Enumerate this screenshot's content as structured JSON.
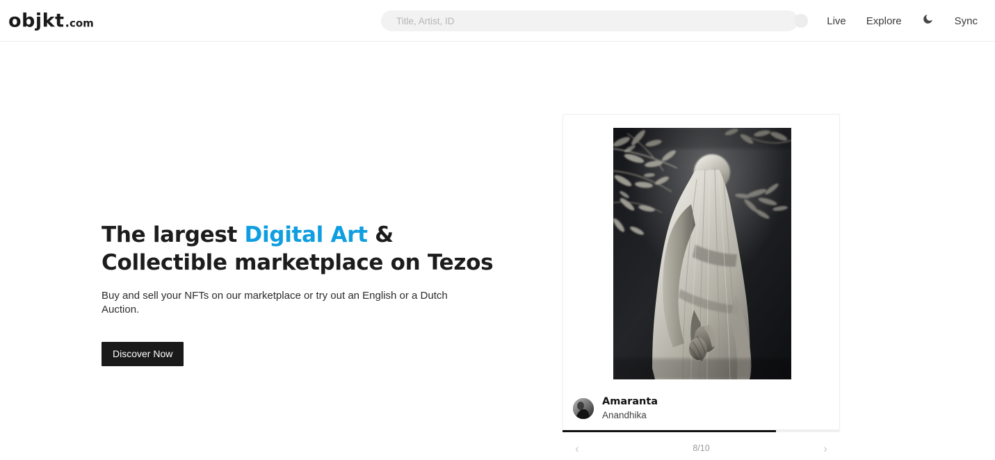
{
  "header": {
    "logo": {
      "name": "objkt",
      "dot": ".",
      "tld": "com"
    },
    "search": {
      "placeholder": "Title, Artist, ID",
      "value": ""
    },
    "nav": {
      "live": "Live",
      "explore": "Explore",
      "theme_toggle_icon": "moon-icon",
      "sync": "Sync",
      "avatar_icon": "avatar-placeholder-icon"
    }
  },
  "hero": {
    "title_part1": "The largest ",
    "title_accent": "Digital Art",
    "title_part2": " & Collectible marketplace on Tezos",
    "subtitle": "Buy and sell your NFTs on our marketplace or try out an English or a Dutch Auction.",
    "cta_label": "Discover Now",
    "accent_color": "#0f9ee0"
  },
  "carousel": {
    "card": {
      "artwork_alt": "Black and white photograph of a veiled figure draped in a white sheet standing beneath foliage",
      "title": "Amaranta",
      "artist": "Anandhika",
      "avatar_alt": "Grayscale profile avatar"
    },
    "progress_percent": 77,
    "pagination": {
      "current": 8,
      "total": 10,
      "label": "8/10",
      "prev_icon": "chevron-left-icon",
      "next_icon": "chevron-right-icon"
    }
  }
}
